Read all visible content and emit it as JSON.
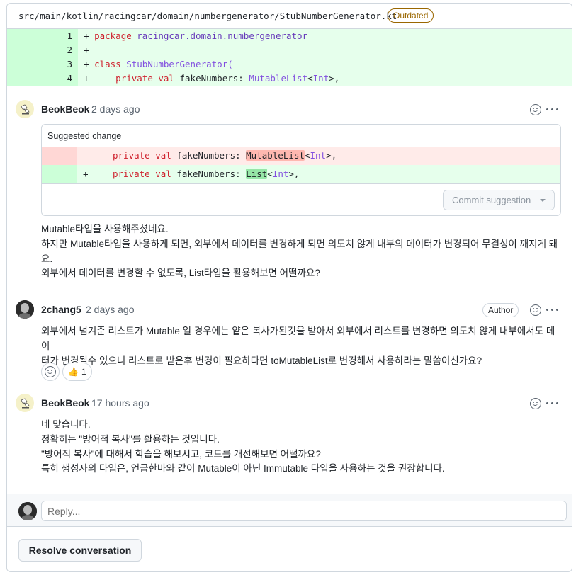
{
  "file": {
    "path": "src/main/kotlin/racingcar/domain/numbergenerator/StubNumberGenerator.kt",
    "badge": "Outdated"
  },
  "diff": {
    "lines": [
      {
        "num": "1",
        "sign": "+",
        "kw": "package",
        "rest": " racingcar.domain.numbergenerator"
      },
      {
        "num": "2",
        "sign": "+"
      },
      {
        "num": "3",
        "sign": "+",
        "kw": "class",
        "rest": " StubNumberGenerator("
      },
      {
        "num": "4",
        "sign": "+",
        "indent": "    ",
        "kw": "private val",
        "mid": " fakeNumbers: ",
        "type": "MutableList",
        "lt": "<",
        "inner": "Int",
        "gt": ">,"
      }
    ]
  },
  "comments": [
    {
      "author": "BeokBeok",
      "time": "2 days ago",
      "suggestion": {
        "title": "Suggested change",
        "del": {
          "sign": "-",
          "kw": "private val",
          "mid": " fakeNumbers: ",
          "type": "MutableList",
          "lt": "<",
          "inner": "Int",
          "gt": ">,"
        },
        "add": {
          "sign": "+",
          "kw": "private val",
          "mid": " fakeNumbers: ",
          "type": "List",
          "lt": "<",
          "inner": "Int",
          "gt": ">,"
        },
        "commit_label": "Commit suggestion"
      },
      "lines": [
        "Mutable타입을 사용해주셨네요.",
        "하지만 Mutable타입을 사용하게 되면, 외부에서 데이터를 변경하게 되면 의도치 않게 내부의 데이터가 변경되어 무결성이 깨지게 돼",
        "요.",
        "외부에서 데이터를 변경할 수 없도록, List타입을 활용해보면 어떨까요?"
      ]
    },
    {
      "author": "2chang5",
      "time": "2 days ago",
      "badge": "Author",
      "lines": [
        "외부에서 넘겨준 리스트가 Mutable 일 경우에는 얕은 복사가된것을 받아서 외부에서 리스트를 변경하면 의도치 않게 내부에서도 데이",
        "터가 변경될수 있으니 리스트로 받은후 변경이 필요하다면 toMutableList로 변경해서 사용하라는 말씀이신가요?"
      ],
      "reaction": {
        "emoji": "👍",
        "count": "1"
      }
    },
    {
      "author": "BeokBeok",
      "time": "17 hours ago",
      "lines": [
        "네 맞습니다.",
        "정확히는 \"방어적 복사\"를 활용하는 것입니다.",
        "\"방어적 복사\"에 대해서 학습을 해보시고, 코드를 개선해보면 어떨까요?",
        "특히 생성자의 타입은, 언급한바와 같이 Mutable이 아닌 Immutable 타입을 사용하는 것을 권장합니다."
      ]
    }
  ],
  "reply": {
    "placeholder": "Reply..."
  },
  "resolve_label": "Resolve conversation"
}
